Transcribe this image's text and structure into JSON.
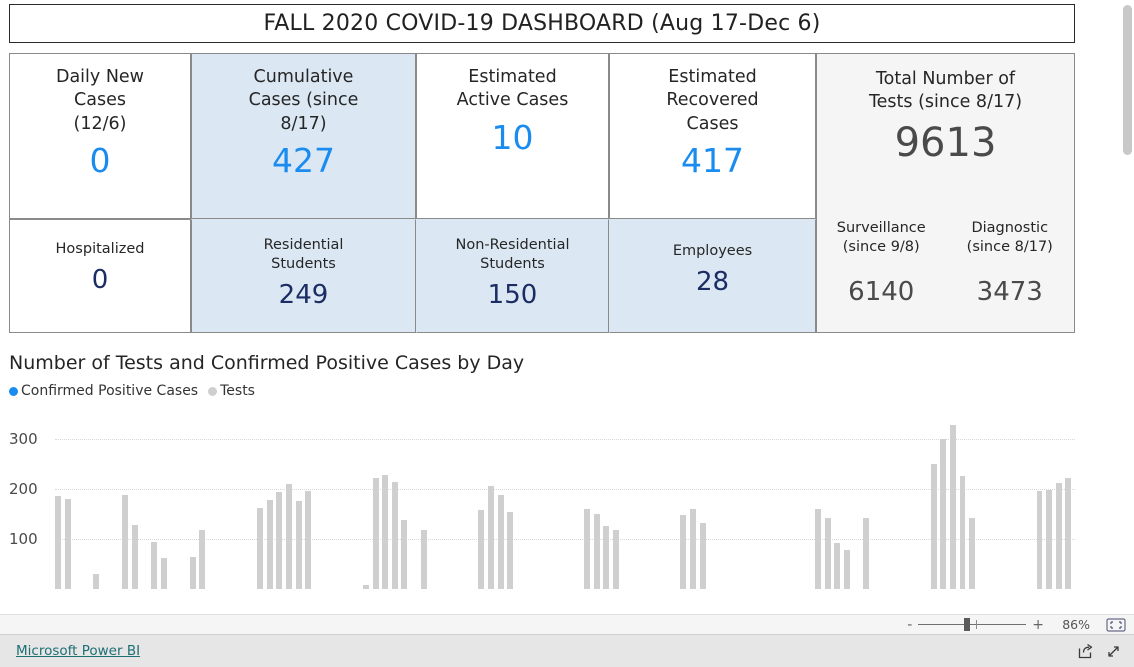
{
  "header": {
    "title": "FALL 2020 COVID-19 DASHBOARD (Aug 17-Dec 6)"
  },
  "kpis": {
    "daily_new": {
      "label_line1": "Daily New",
      "label_line2": "Cases",
      "label_line3": "(12/6)",
      "value": "0"
    },
    "hospitalized": {
      "label": "Hospitalized",
      "value": "0"
    },
    "cumulative": {
      "label_line1": "Cumulative",
      "label_line2": "Cases (since",
      "label_line3": "8/17)",
      "value": "427"
    },
    "residential": {
      "label_line1": "Residential",
      "label_line2": "Students",
      "value": "249"
    },
    "active": {
      "label_line1": "Estimated",
      "label_line2": "Active Cases",
      "value": "10"
    },
    "non_residential": {
      "label_line1": "Non-Residential",
      "label_line2": "Students",
      "value": "150"
    },
    "recovered": {
      "label_line1": "Estimated",
      "label_line2": "Recovered",
      "label_line3": "Cases",
      "value": "417"
    },
    "employees": {
      "label": "Employees",
      "value": "28"
    },
    "total_tests": {
      "label_line1": "Total Number of",
      "label_line2": "Tests (since 8/17)",
      "value": "9613",
      "surveillance_label_line1": "Surveillance",
      "surveillance_label_line2": "(since 9/8)",
      "surveillance_value": "6140",
      "diagnostic_label_line1": "Diagnostic",
      "diagnostic_label_line2": "(since 8/17)",
      "diagnostic_value": "3473"
    }
  },
  "colors": {
    "accent_blue": "#1a8cf0",
    "navy": "#1b2d63",
    "card_blue_bg": "#dbe8f4",
    "card_gray_bg": "#f5f5f5",
    "bar_gray": "#cfcfcf",
    "link_teal": "#1d6f74"
  },
  "chart_data": {
    "type": "bar",
    "title": "Number of Tests and Confirmed Positive Cases by Day",
    "xlabel": "",
    "ylabel": "",
    "ylim": [
      0,
      360
    ],
    "yticks": [
      100,
      200,
      300
    ],
    "ytick_labels": [
      "100",
      "200",
      "300"
    ],
    "grid": true,
    "legend_position": "top-left",
    "legend": [
      {
        "name": "Confirmed Positive Cases",
        "color": "#1a8cf0",
        "marker": "dot"
      },
      {
        "name": "Tests",
        "color": "#cfcfcf",
        "marker": "dot"
      }
    ],
    "series": [
      {
        "name": "Tests",
        "color": "#cfcfcf",
        "values": [
          186,
          181,
          0,
          0,
          31,
          0,
          0,
          189,
          129,
          0,
          94,
          62,
          0,
          0,
          65,
          119,
          0,
          0,
          0,
          0,
          0,
          163,
          178,
          194,
          211,
          176,
          196,
          0,
          0,
          0,
          0,
          0,
          8,
          222,
          228,
          215,
          139,
          0,
          119,
          0,
          0,
          0,
          0,
          0,
          159,
          207,
          189,
          155,
          0,
          0,
          0,
          0,
          0,
          0,
          0,
          160,
          150,
          127,
          119,
          0,
          0,
          0,
          0,
          0,
          0,
          149,
          160,
          133,
          0,
          0,
          0,
          0,
          0,
          0,
          0,
          0,
          0,
          0,
          0,
          161,
          143,
          93,
          79,
          0,
          143,
          0,
          0,
          0,
          0,
          0,
          0,
          250,
          301,
          329,
          227,
          142,
          0,
          0,
          0,
          0,
          0,
          0,
          196,
          199,
          213,
          222
        ]
      },
      {
        "name": "Confirmed Positive Cases",
        "color": "#1a8cf0",
        "values": []
      }
    ],
    "note": "Plot is clipped by the scroll viewport; bars below ~y=100 and the x axis labels are not visible."
  },
  "zoom_control": {
    "minus": "-",
    "plus": "+",
    "percent": "86%",
    "fit_icon": "fit-to-page-icon"
  },
  "footer": {
    "link": "Microsoft Power BI",
    "share_icon": "share-icon",
    "fullscreen_icon": "fullscreen-icon"
  }
}
